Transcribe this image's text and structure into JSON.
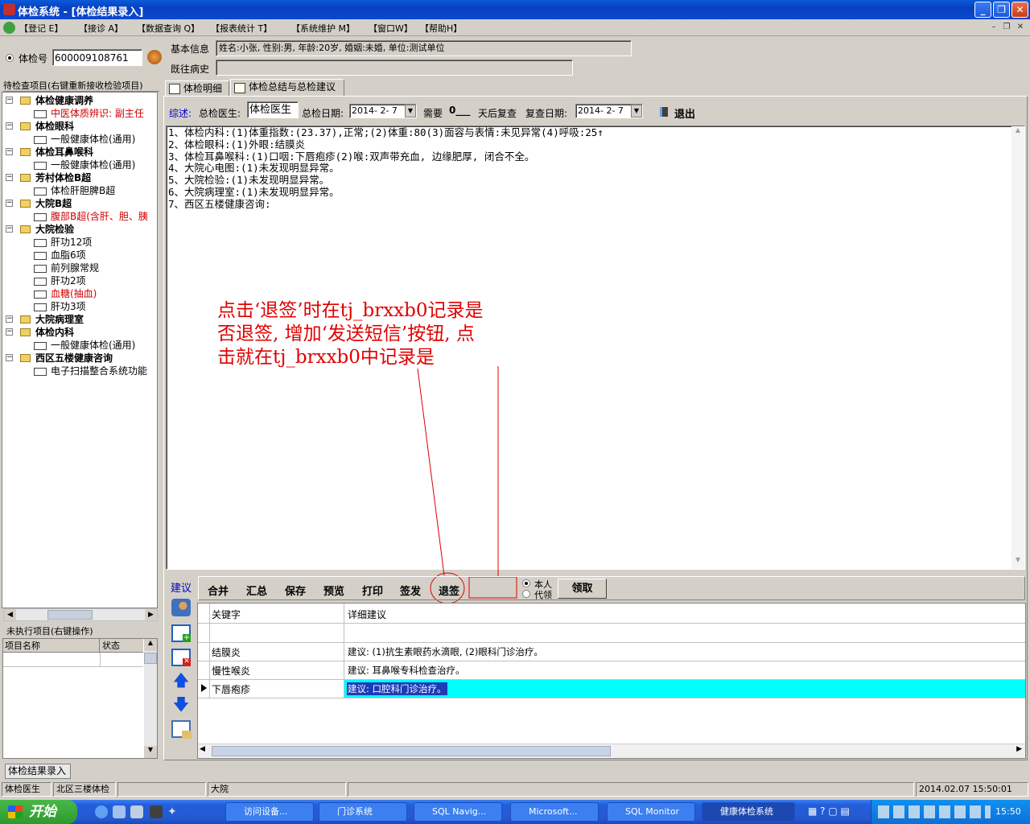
{
  "window": {
    "title": "体检系统 - [体检结果录入]"
  },
  "menu": [
    "【登记 E】",
    "【接诊 A】",
    "【数据查询 Q】",
    "【报表统计 T】",
    "【系统维护 M】",
    "【窗口W】",
    "【帮助H】"
  ],
  "exam": {
    "radio_label": "体检号",
    "exam_no": "600009108761"
  },
  "basic_info": {
    "label": "基本信息",
    "value": "姓名:小张, 性别:男, 年龄:20岁, 婚姻:未婚, 单位:测试单位"
  },
  "history": {
    "label": "既往病史",
    "value": ""
  },
  "left_panel": {
    "title": "待检查项目(右键重新接收检验项目)",
    "tree": [
      {
        "group": "体检健康调养",
        "items": [
          {
            "label": "中医体质辨识: 副主任",
            "red": true
          }
        ]
      },
      {
        "group": "体检眼科",
        "items": [
          {
            "label": "一般健康体检(通用)",
            "red": false
          }
        ]
      },
      {
        "group": "体检耳鼻喉科",
        "items": [
          {
            "label": "一般健康体检(通用)",
            "red": false
          }
        ]
      },
      {
        "group": "芳村体检B超",
        "items": [
          {
            "label": "体检肝胆脾B超",
            "red": false
          }
        ]
      },
      {
        "group": "大院B超",
        "items": [
          {
            "label": "腹部B超(含肝、胆、胰",
            "red": true
          }
        ]
      },
      {
        "group": "大院检验",
        "items": [
          {
            "label": "肝功12项",
            "red": false
          },
          {
            "label": "血脂6项",
            "red": false
          },
          {
            "label": "前列腺常规",
            "red": false
          },
          {
            "label": "肝功2项",
            "red": false
          },
          {
            "label": "血糖(抽血)",
            "red": true
          },
          {
            "label": "肝功3项",
            "red": false
          }
        ]
      },
      {
        "group": "大院病理室",
        "items": []
      },
      {
        "group": "体检内科",
        "items": [
          {
            "label": "一般健康体检(通用)",
            "red": false
          }
        ]
      },
      {
        "group": "西区五楼健康咨询",
        "items": [
          {
            "label": "电子扫描整合系统功能",
            "red": false
          }
        ]
      }
    ],
    "pending_title": "未执行项目(右键操作)",
    "pending_cols": [
      "项目名称",
      "状态"
    ]
  },
  "tabs": [
    "体检明细",
    "体检总结与总检建议"
  ],
  "summary_bar": {
    "label": "综述:",
    "doctor_label": "总检医生:",
    "doctor": "体检医生",
    "date_label": "总检日期:",
    "date": "2014- 2- 7",
    "need_label": "需要",
    "days": "0___",
    "days_suffix": "天后复查",
    "recheck_label": "复查日期:",
    "recheck_date": "2014- 2- 7",
    "exit": "退出"
  },
  "summary_lines": [
    "1、体检内科:(1)体重指数:(23.37),正常;(2)体重:80(3)面容与表情:未见异常(4)呼吸:25↑",
    "2、体检眼科:(1)外眼:结膜炎",
    "3、体检耳鼻喉科:(1)口咽:下唇疱疹(2)喉:双声带充血, 边缘肥厚, 闭合不全。",
    "4、大院心电图:(1)未发现明显异常。",
    "5、大院检验:(1)未发现明显异常。",
    "6、大院病理室:(1)未发现明显异常。",
    "7、西区五楼健康咨询:"
  ],
  "annotation": {
    "lines": [
      "点击‘退签’时在tj_brxxb0记录是",
      "否退签, 增加‘发送短信’按钮, 点",
      "击就在tj_brxxb0中记录是"
    ],
    "color": "#e00000"
  },
  "advice": {
    "label": "建议",
    "buttons": [
      "合并",
      "汇总",
      "保存",
      "预览",
      "打印",
      "签发",
      "退签"
    ],
    "radio": [
      "本人",
      "代领"
    ],
    "collect": "领取",
    "columns": [
      "关键字",
      "详细建议"
    ],
    "rows": [
      {
        "key": "",
        "detail": ""
      },
      {
        "key": "结膜炎",
        "detail": "建议: (1)抗生素眼药水滴眼, (2)眼科门诊治疗。"
      },
      {
        "key": "慢性喉炎",
        "detail": "建议: 耳鼻喉专科检查治疗。"
      },
      {
        "key": "下唇疱疹",
        "detail": "建议: 口腔科门诊治疗。"
      }
    ],
    "selected_color": "#00ffff"
  },
  "mdi_tab": "体检结果录入",
  "status": [
    "体检医生",
    "北区三楼体检",
    "",
    "大院",
    "",
    "2014.02.07 15:50:01"
  ],
  "taskbar": {
    "start": "开始",
    "tasks": [
      "访问设备...",
      "门诊系统",
      "SQL Navig...",
      "Microsoft...",
      "SQL Monitor",
      "健康体检系统"
    ],
    "clock": "15:50"
  },
  "icons": [
    "app-icon",
    "minimize-icon",
    "restore-icon",
    "close-icon",
    "exit-icon",
    "up-arrow-icon",
    "down-arrow-icon"
  ]
}
